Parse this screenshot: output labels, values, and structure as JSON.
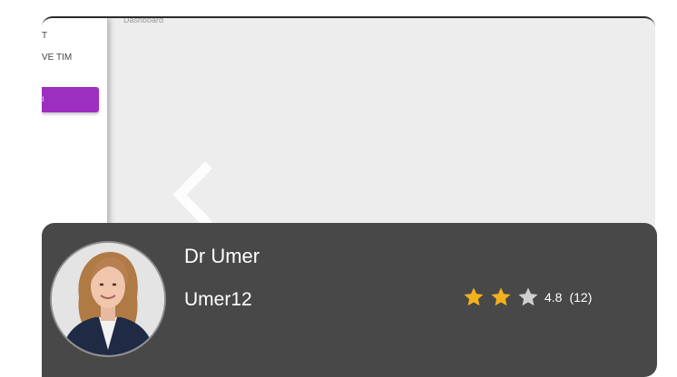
{
  "slide": {
    "header_text": "Dashboard",
    "sidebar_lines": [
      "T",
      "VE TIM"
    ],
    "sidebar_button_label": "d"
  },
  "carousel": {
    "prev_icon": "chevron-left-icon"
  },
  "profile": {
    "name": "Dr Umer",
    "username": "Umer12",
    "avatar_icon": "person-avatar",
    "rating": {
      "filled_stars": 2,
      "total_stars": 3,
      "value": "4.8",
      "count": "(12)"
    }
  },
  "colors": {
    "card_background": "#484848",
    "star_filled": "#f3b21d",
    "star_empty": "#cfcfcf",
    "sidebar_button": "#9c2fc0",
    "slide_background": "#ededed"
  }
}
